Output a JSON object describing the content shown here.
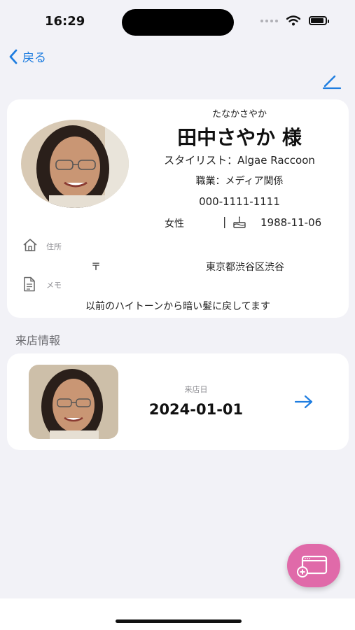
{
  "status_bar": {
    "time": "16:29"
  },
  "nav": {
    "back_label": "戻る"
  },
  "profile": {
    "furigana": "たなかさやか",
    "name": "田中さやか",
    "honorific": "様",
    "stylist": "スタイリスト：Algae Raccoon",
    "occupation": "職業：メディア関係",
    "phone": "000-1111-1111",
    "gender": "女性",
    "separator": "|",
    "birthday": "1988-11-06",
    "address_label": "住所",
    "postal_mark": "〒",
    "address": "東京都渋谷区渋谷",
    "memo_label": "メモ",
    "memo": "以前のハイトーンから暗い髪に戻してます"
  },
  "visits": {
    "section_title": "来店情報",
    "items": [
      {
        "label": "来店日",
        "date": "2024-01-01"
      }
    ]
  },
  "icons": {
    "back": "chevron-left-icon",
    "edit": "pencil-icon",
    "home": "home-icon",
    "memo": "document-icon",
    "birthday": "cake-icon",
    "arrow": "arrow-right-icon",
    "add_visit": "add-window-icon"
  },
  "colors": {
    "accent": "#1e7de0",
    "fab": "#e06aa9",
    "background": "#f2f2f7"
  }
}
